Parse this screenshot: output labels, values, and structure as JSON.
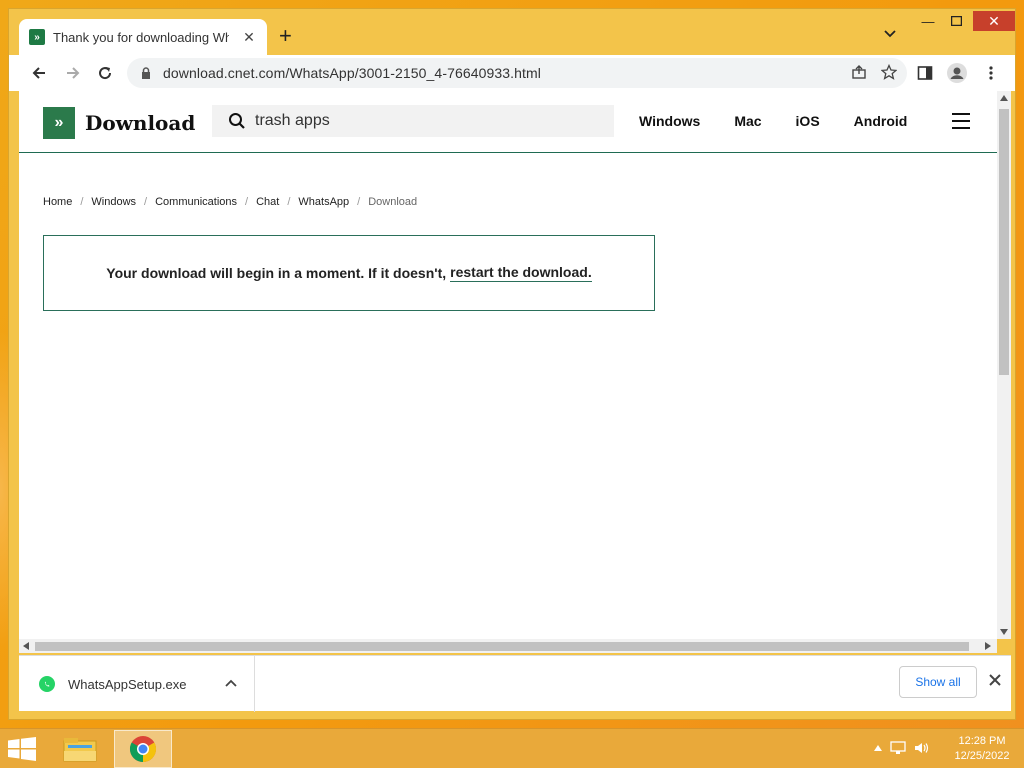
{
  "browser": {
    "tab_title": "Thank you for downloading WhatsApp",
    "url": "download.cnet.com/WhatsApp/3001-2150_4-76640933.html"
  },
  "site": {
    "logo_text": "Download",
    "search_value": "trash apps",
    "nav": [
      "Windows",
      "Mac",
      "iOS",
      "Android"
    ]
  },
  "breadcrumb": [
    "Home",
    "Windows",
    "Communications",
    "Chat",
    "WhatsApp",
    "Download"
  ],
  "notice": {
    "text": "Your download will begin in a moment. If it doesn't,",
    "link": "restart the download."
  },
  "download_bar": {
    "file_name": "WhatsAppSetup.exe",
    "show_all": "Show all"
  },
  "taskbar": {
    "time": "12:28 PM",
    "date": "12/25/2022"
  },
  "colors": {
    "brand_green": "#2b7a4b",
    "link_blue": "#1a73e8",
    "window_frame": "#f3c44a"
  }
}
